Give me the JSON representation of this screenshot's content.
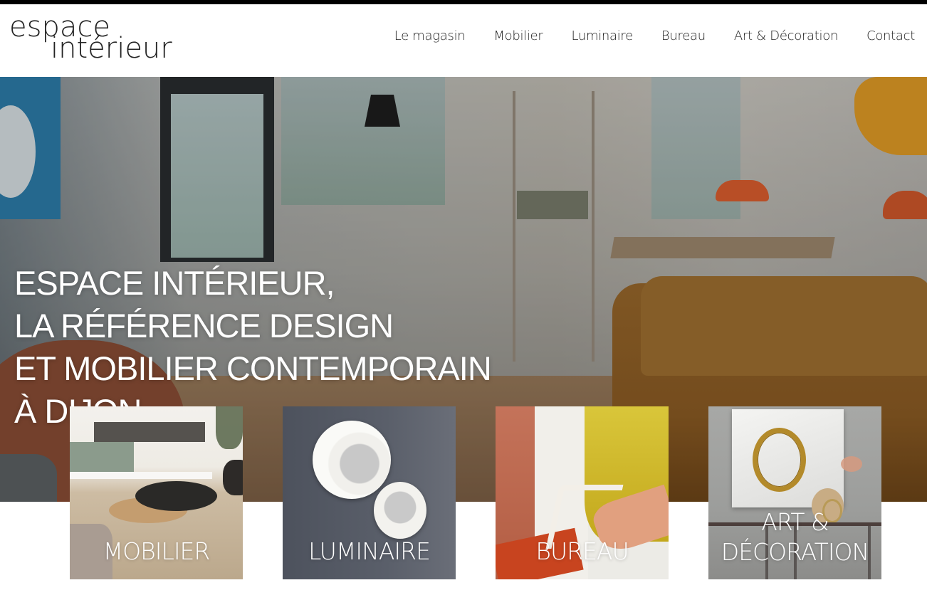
{
  "header": {
    "logo": {
      "line1": "espace",
      "line2": "intérieur"
    },
    "nav": [
      {
        "label": "Le magasin"
      },
      {
        "label": "Mobilier"
      },
      {
        "label": "Luminaire"
      },
      {
        "label": "Bureau"
      },
      {
        "label": "Art & Décoration"
      },
      {
        "label": "Contact"
      }
    ]
  },
  "hero": {
    "title_lines": [
      "ESPACE INTÉRIEUR,",
      "LA RÉFÉRENCE DESIGN",
      "ET MOBILIER CONTEMPORAIN",
      "À DIJON"
    ]
  },
  "categories": [
    {
      "label": "MOBILIER"
    },
    {
      "label": "LUMINAIRE"
    },
    {
      "label": "BUREAU"
    },
    {
      "label_line1": "ART &",
      "label_line2": "DÉCORATION"
    }
  ],
  "colors": {
    "top_strip": "#000000",
    "nav_text": "#1e1e1e",
    "hero_text": "#ffffff",
    "background": "#ffffff"
  }
}
